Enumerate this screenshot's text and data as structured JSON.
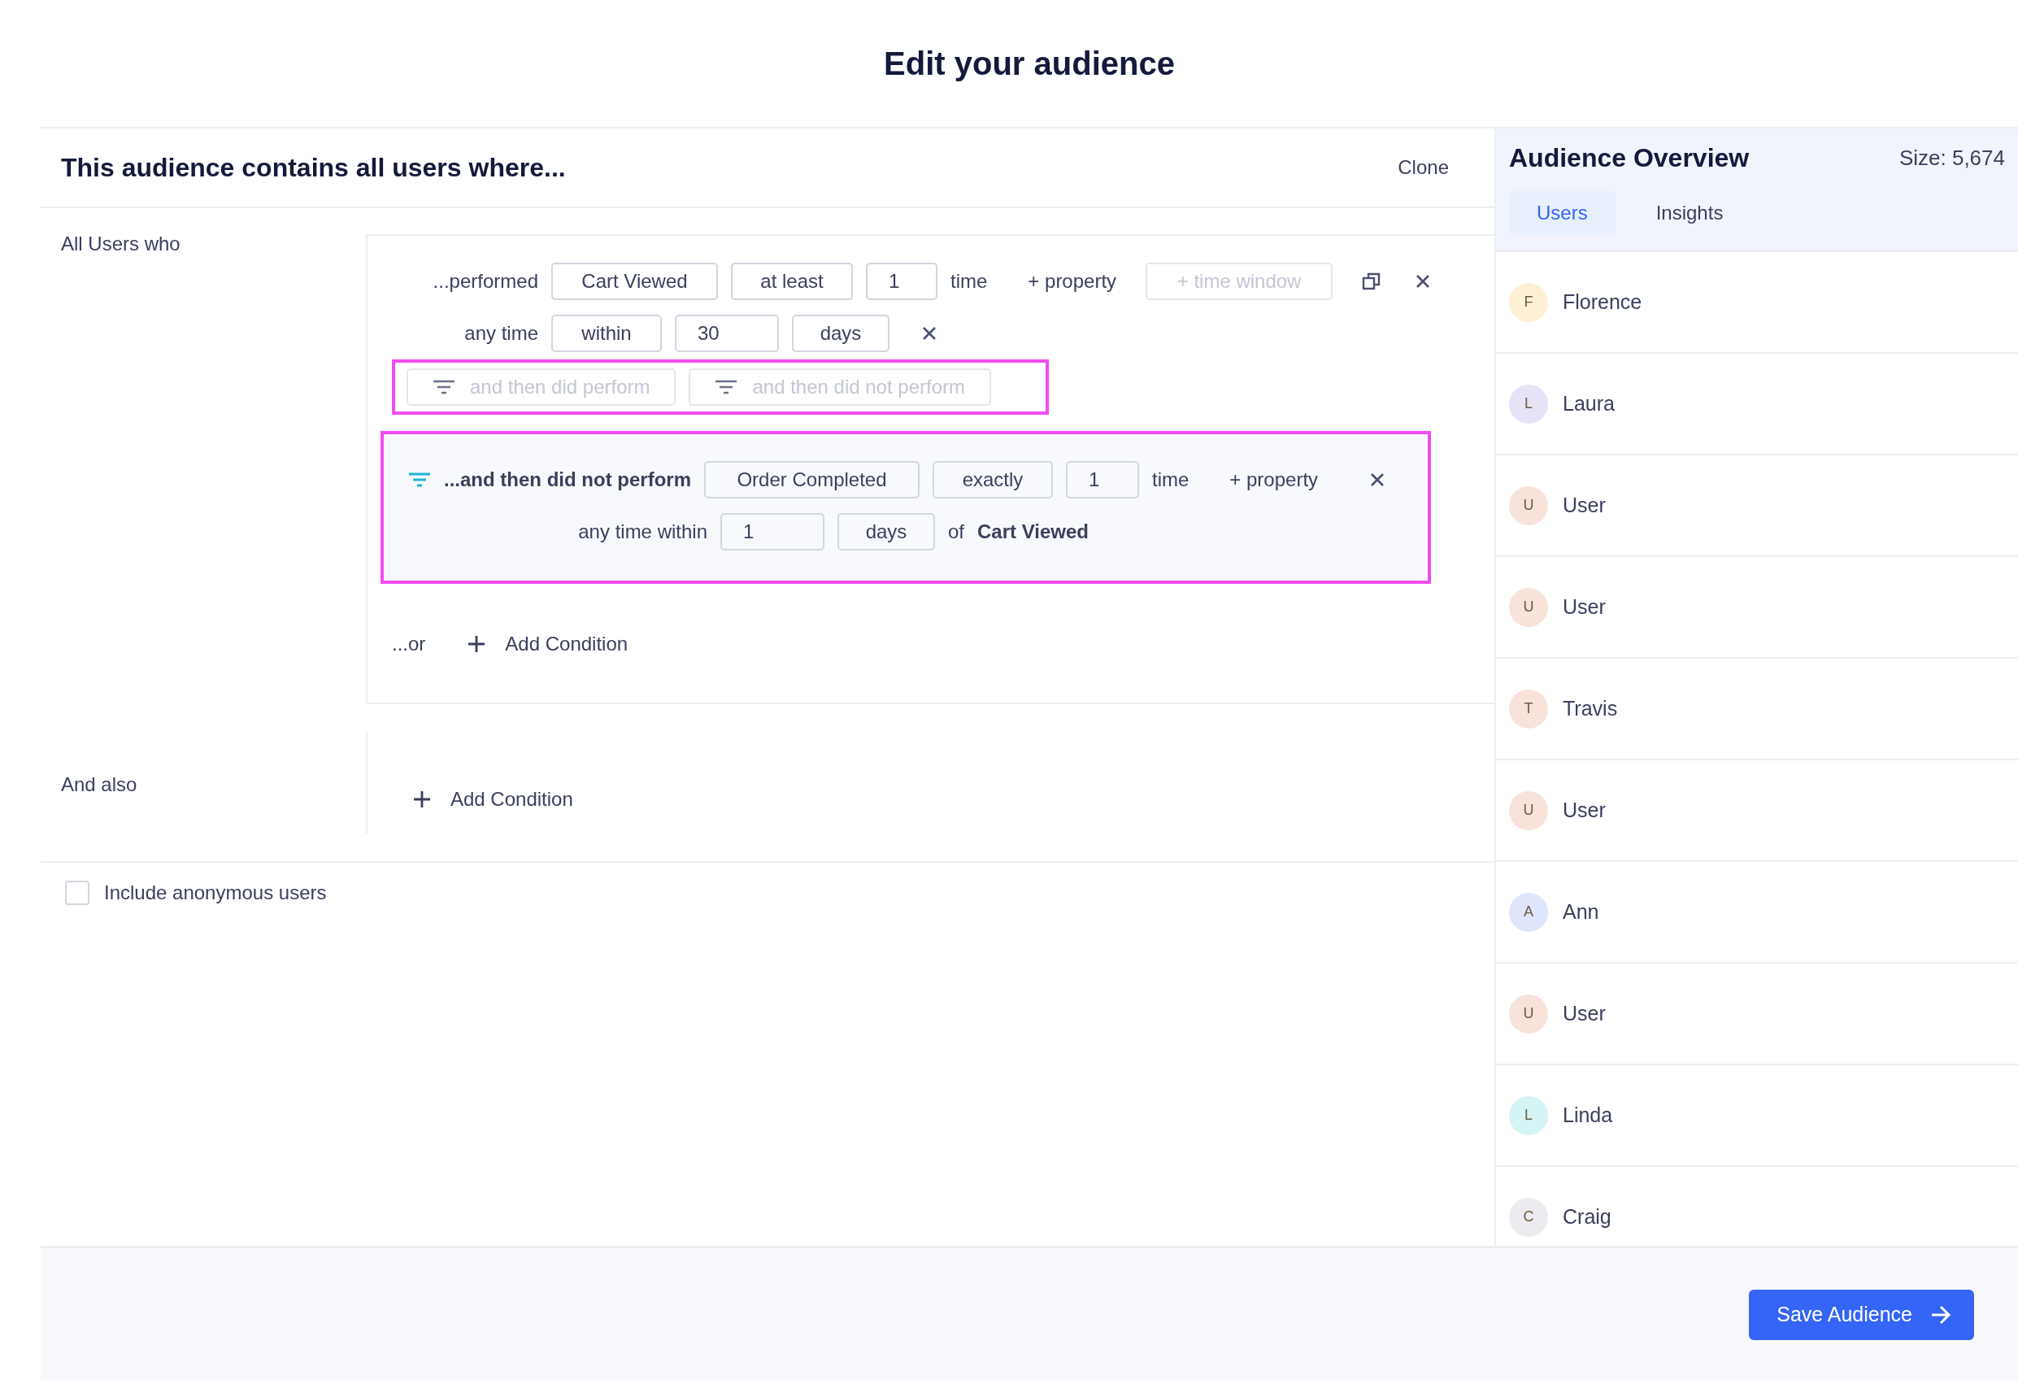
{
  "title": "Edit your audience",
  "definition": {
    "heading": "This audience contains all users where...",
    "clone_label": "Clone",
    "groups": [
      {
        "label": "All Users who",
        "conditions": [
          {
            "lead": "...performed",
            "event": "Cart Viewed",
            "operator": "at least",
            "count": "1",
            "unit": "time",
            "property_link": "+ property",
            "time_window": {
              "label": "+ time window",
              "disabled": true
            },
            "timing": {
              "label": "any time",
              "mode": "within",
              "amount": "30",
              "period": "days"
            },
            "sequence_options": [
              {
                "label": "and then did perform",
                "disabled": true
              },
              {
                "label": "and then did not perform",
                "disabled": true
              }
            ],
            "sequence": {
              "lead": "...and then did not perform",
              "event": "Order Completed",
              "operator": "exactly",
              "count": "1",
              "unit": "time",
              "property_link": "+ property",
              "timing_label": "any time within",
              "amount": "1",
              "period": "days",
              "of_label": "of",
              "reference_event": "Cart Viewed"
            }
          }
        ],
        "or_label": "...or",
        "add_label": "Add Condition"
      },
      {
        "label": "And also",
        "add_label": "Add Condition"
      }
    ]
  },
  "include_anonymous": {
    "label": "Include anonymous users",
    "checked": false
  },
  "overview": {
    "title": "Audience Overview",
    "size": "Size: 5,674",
    "tabs": [
      {
        "label": "Users",
        "selected": true
      },
      {
        "label": "Insights",
        "selected": false
      }
    ],
    "users": [
      {
        "initial": "F",
        "name": "Florence",
        "color": "#fdf0d5"
      },
      {
        "initial": "L",
        "name": "Laura",
        "color": "#e6e3f7"
      },
      {
        "initial": "U",
        "name": "User",
        "color": "#f7e3da"
      },
      {
        "initial": "U",
        "name": "User",
        "color": "#f7e3da"
      },
      {
        "initial": "T",
        "name": "Travis",
        "color": "#f7e3da"
      },
      {
        "initial": "U",
        "name": "User",
        "color": "#f7e3da"
      },
      {
        "initial": "A",
        "name": "Ann",
        "color": "#dfe5fb"
      },
      {
        "initial": "U",
        "name": "User",
        "color": "#f7e3da"
      },
      {
        "initial": "L",
        "name": "Linda",
        "color": "#d5f4f5"
      },
      {
        "initial": "C",
        "name": "Craig",
        "color": "#ececf0"
      }
    ]
  },
  "save_button": "Save Audience"
}
